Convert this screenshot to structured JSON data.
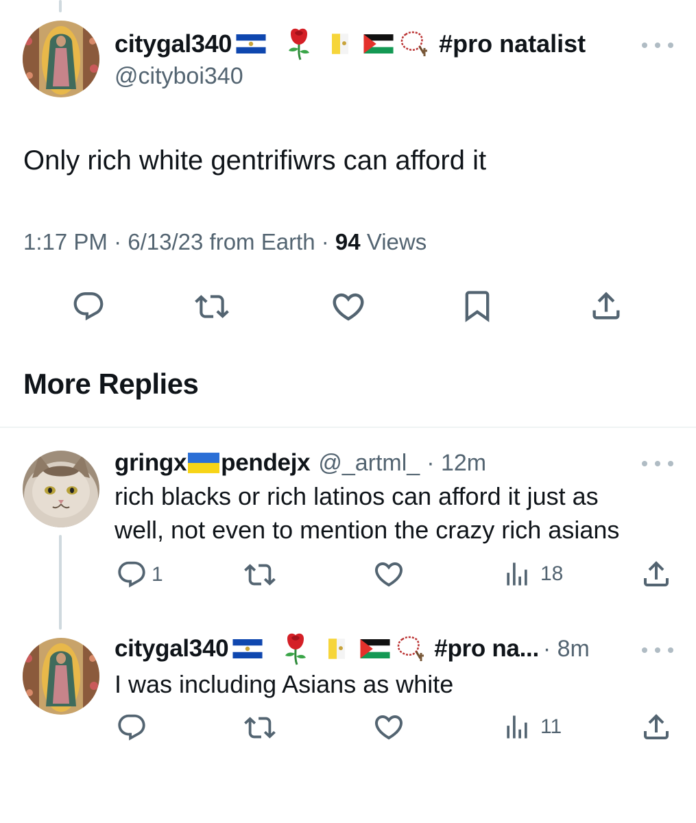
{
  "main_tweet": {
    "display_name": "citygal340",
    "handle": "@cityboi340",
    "hashtag": "#pro natalist",
    "text": "Only rich white gentrifiwrs can afford it",
    "time": "1:17 PM",
    "date": "6/13/23",
    "source": "from Earth",
    "views_count": "94",
    "views_label": "Views",
    "badges": [
      "el-salvador-flag",
      "rose",
      "vatican-flag",
      "palestine-flag",
      "rosary"
    ]
  },
  "section": {
    "title": "More Replies"
  },
  "replies": [
    {
      "display_name_part1": "gringx",
      "display_name_part2": "pendejx",
      "handle": "@_artml_",
      "time": "· 12m",
      "text_line1": "rich blacks or rich latinos can afford it just as",
      "text_line2": "well, not even to mention the crazy rich asians",
      "reply_count": "1",
      "views_count": "18",
      "badges": [
        "ukraine-flag"
      ]
    },
    {
      "display_name": "citygal340",
      "hashtag_truncated": "#pro na...",
      "time": "· 8m",
      "text": "I was including Asians as white",
      "views_count": "11",
      "badges": [
        "el-salvador-flag",
        "rose",
        "vatican-flag",
        "palestine-flag",
        "rosary"
      ]
    }
  ],
  "colors": {
    "text_primary": "#0f1419",
    "text_secondary": "#536471",
    "thread_line": "#cfd9de",
    "divider": "#eff3f4"
  }
}
